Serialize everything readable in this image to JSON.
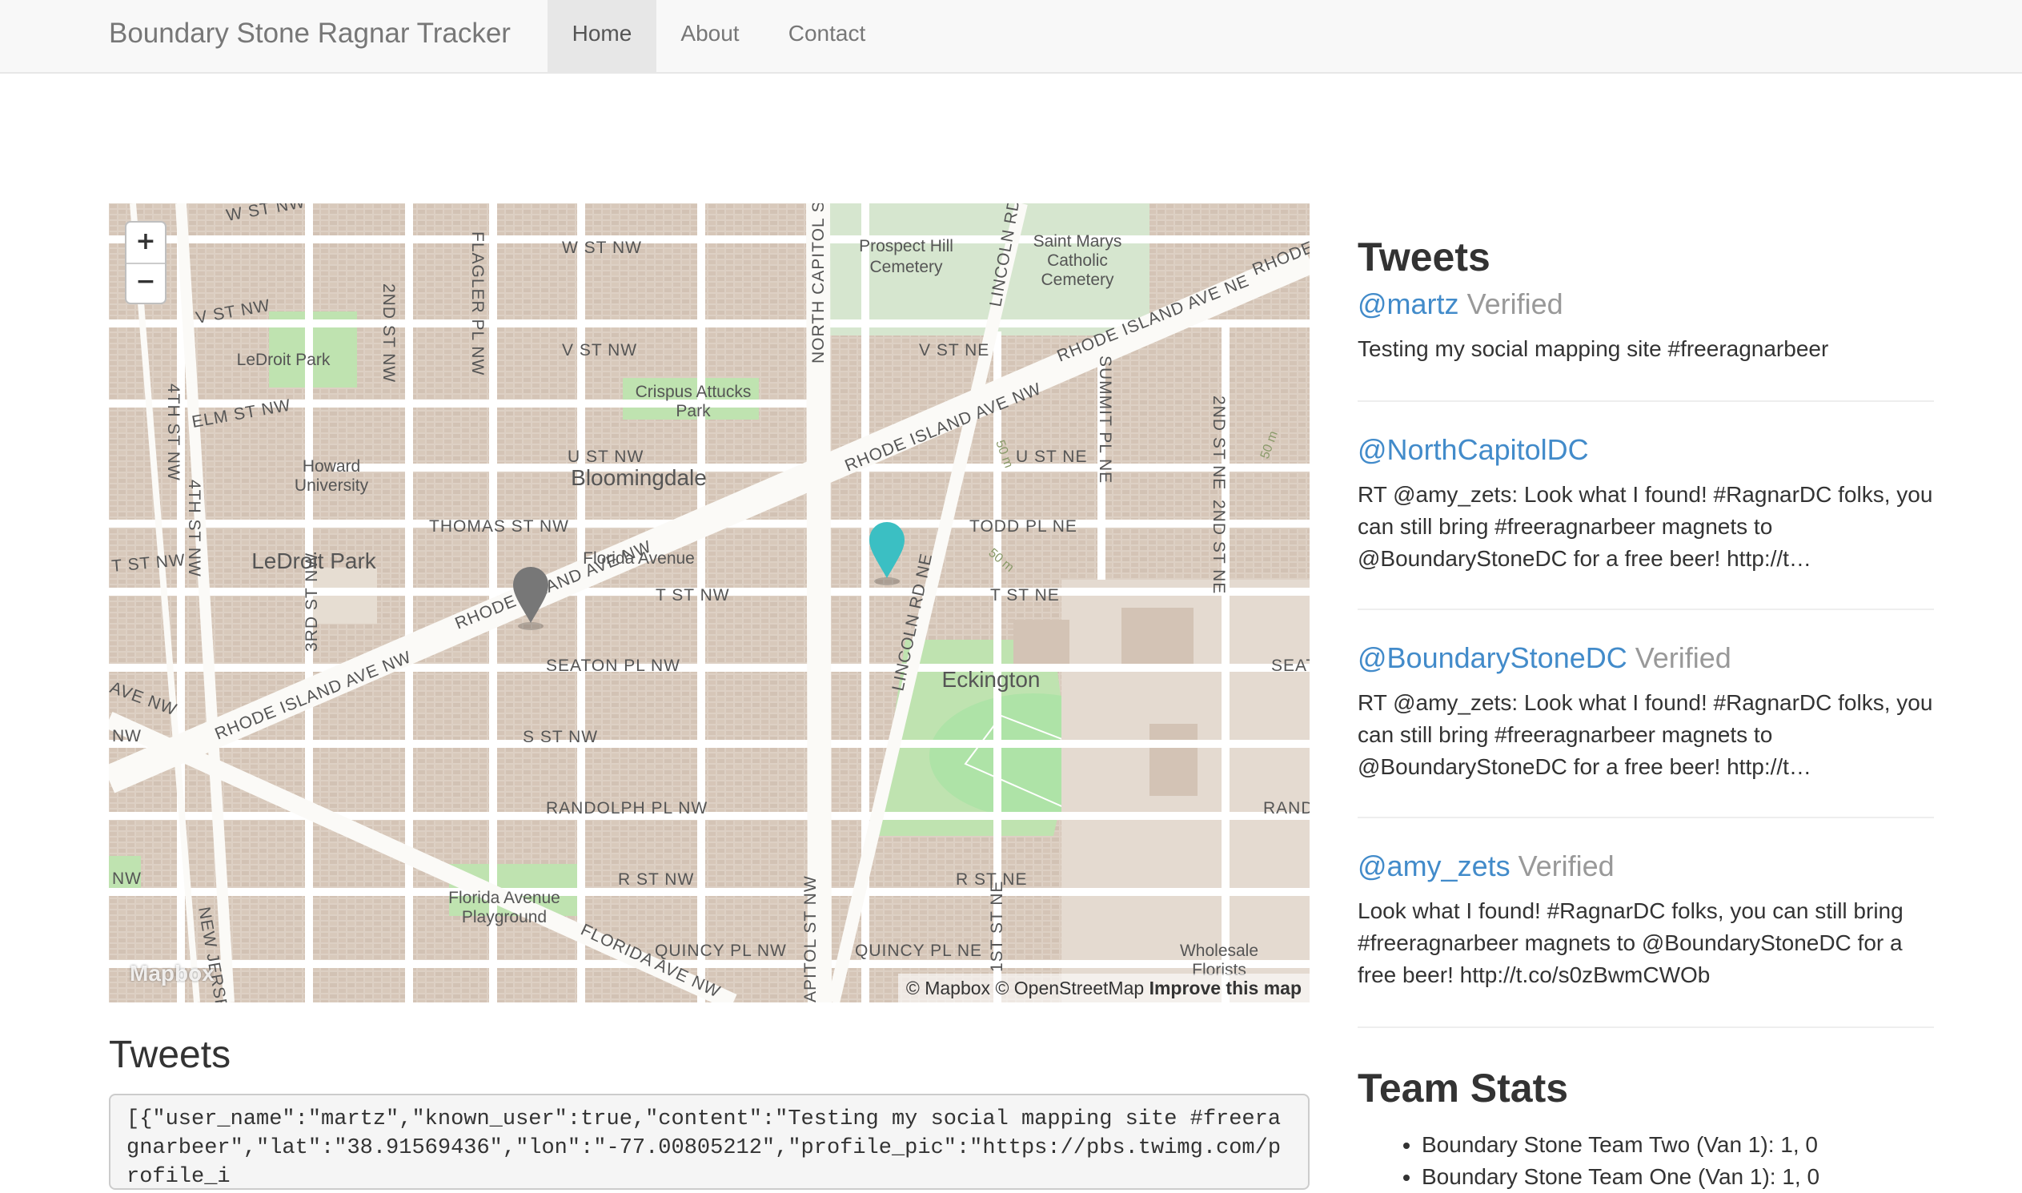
{
  "navbar": {
    "brand": "Boundary Stone Ragnar Tracker",
    "links": [
      "Home",
      "About",
      "Contact"
    ],
    "active": "Home"
  },
  "map": {
    "zoom_in": "+",
    "zoom_out": "−",
    "logo": "Mapbox",
    "attribution": {
      "mapbox": "© Mapbox",
      "osm": "© OpenStreetMap",
      "improve": "Improve this map"
    },
    "markers": [
      {
        "name": "gray-marker-icon",
        "color": "#777777"
      },
      {
        "name": "teal-marker-icon",
        "color": "#3bbfc3"
      }
    ],
    "labels": {
      "w_st_nw_a": "W ST NW",
      "w_st_nw_b": "W ST NW",
      "v_st_nw_a": "V ST NW",
      "v_st_nw_b": "V ST NW",
      "v_st_ne": "V ST NE",
      "elm_st_nw": "ELM ST NW",
      "u_st_nw": "U ST NW",
      "u_st_ne": "U ST NE",
      "thomas_st_nw": "THOMAS ST NW",
      "todd_pl_ne": "TODD PL NE",
      "t_st_nw_a": "T ST NW",
      "t_st_nw_b": "T ST NW",
      "t_st_ne": "T ST NE",
      "seaton_pl_nw": "SEATON PL NW",
      "s_st_nw": "S ST NW",
      "randolph_pl_nw": "RANDOLPH PL NW",
      "r_st_nw": "R ST NW",
      "r_st_ne": "R ST NE",
      "quincy_pl_nw": "QUINCY PL NW",
      "quincy_pl_ne": "QUINCY PL NE",
      "ave_nw_left": "AVE NW",
      "nw_left": "NW",
      "nw_left_2": "NW",
      "seat": "SEAT",
      "rando": "RANDO",
      "rhode_island_main": "RHODE ISLAND AVE NW",
      "rhode_island_lower": "RHODE ISLAND AVE NW",
      "rhode_island_upper": "RHODE ISLAND AVE NW",
      "rhode_island_ne": "RHODE ISLAND AVE NE",
      "rhode_cut": "RHODE",
      "florida_ave_nw": "FLORIDA AVE NW",
      "north_capitol_s": "NORTH CAPITOL S",
      "lincoln_rd_ne_top": "LINCOLN RD NE",
      "lincoln_rd_ne_bot": "LINCOLN RD NE",
      "flagler_pl_nw": "FLAGLER PL NW",
      "second_st_nw": "2ND ST NW",
      "third_st_nw": "3RD ST NW",
      "fourth_st_nw_a": "4TH ST NW",
      "fourth_st_nw_b": "4TH ST NW",
      "summit_pl_ne": "SUMMIT PL NE",
      "second_st_ne_a": "2ND ST NE",
      "second_st_ne_b": "2ND ST NE",
      "first_st_ne": "1ST ST NE",
      "apitol_st_nw": "APITOL ST NW",
      "new_jersey": "NEW JERSEY",
      "prospect_hill_1": "Prospect Hill",
      "prospect_hill_2": "Cemetery",
      "saint_marys_1": "Saint Marys",
      "saint_marys_2": "Catholic",
      "saint_marys_3": "Cemetery",
      "ledroit_park_small": "LeDroit Park",
      "crispus_1": "Crispus Attucks",
      "crispus_2": "Park",
      "howard_1": "Howard",
      "howard_2": "University",
      "bloomingdale": "Bloomingdale",
      "ledroit_park_large": "LeDroit Park",
      "eckington": "Eckington",
      "florida_playground_1": "Florida Avenue",
      "florida_playground_2": "Playground",
      "wholesale_1": "Wholesale",
      "wholesale_2": "Florists",
      "fifty_m_a": "50 m",
      "fifty_m_b": "50 m",
      "fifty_m_c": "50 m"
    }
  },
  "tweets_section": {
    "title": "Tweets",
    "json_preview": "[{\"user_name\":\"martz\",\"known_user\":true,\"content\":\"Testing my social mapping site #freeragnarbeer\",\"lat\":\"38.91569436\",\"lon\":\"-77.00805212\",\"profile_pic\":\"https://pbs.twimg.com/profile_i"
  },
  "sidebar": {
    "title": "Tweets",
    "tweets": [
      {
        "handle": "@martz",
        "verified": "Verified",
        "text": "Testing my social mapping site #freeragnarbeer"
      },
      {
        "handle": "@NorthCapitolDC",
        "verified": "",
        "text": "RT @amy_zets: Look what I found! #RagnarDC folks, you can still bring #freeragnarbeer magnets to @BoundaryStoneDC for a free beer! http://t…"
      },
      {
        "handle": "@BoundaryStoneDC",
        "verified": "Verified",
        "text": "RT @amy_zets: Look what I found! #RagnarDC folks, you can still bring #freeragnarbeer magnets to @BoundaryStoneDC for a free beer! http://t…"
      },
      {
        "handle": "@amy_zets",
        "verified": "Verified",
        "text": "Look what I found! #RagnarDC folks, you can still bring #freeragnarbeer magnets to @BoundaryStoneDC for a free beer! http://t.co/s0zBwmCWOb"
      }
    ],
    "stats_title": "Team Stats",
    "stats": [
      "Boundary Stone Team Two (Van 1): 1, 0",
      "Boundary Stone Team One (Van 1): 1, 0"
    ]
  }
}
